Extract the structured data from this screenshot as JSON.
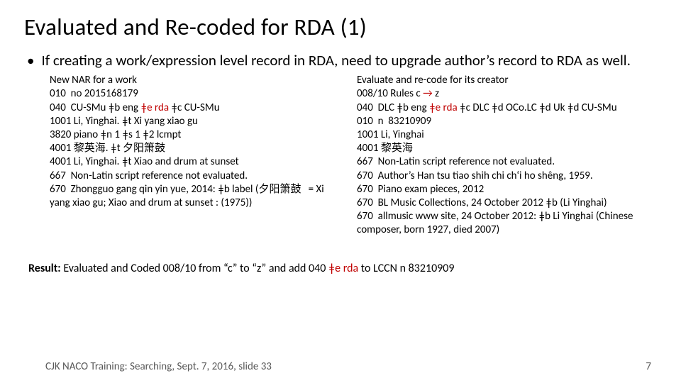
{
  "title": "Evaluated and Re-coded for RDA (1)",
  "bullet": "If creating a work/expression level record in RDA, need to upgrade author’s record to RDA as well.",
  "left": {
    "heading": "New NAR for a work",
    "l1": "010  no 2015168179",
    "l2a": "040  CU-SMu ǂb eng ",
    "l2_red": "ǂe rda",
    "l2b": " ǂc CU-SMu",
    "l3": "1001 Li, Yinghai. ǂt Xi yang xiao gu",
    "l4": "3820 piano ǂn 1 ǂs 1 ǂ2 lcmpt",
    "l5": "4001 黎英海. ǂt 夕阳箫鼓",
    "l6": "4001 Li, Yinghai. ǂt Xiao and drum at sunset",
    "l7": "667  Non-Latin script reference not evaluated.",
    "l8": "670  Zhongguo gang qin yin yue, 2014: ǂb label (夕阳箫鼓   = Xi yang xiao gu; Xiao and drum at sunset : (1975))"
  },
  "right": {
    "heading": "Evaluate and re-code for its creator",
    "r1a": "008/10 Rules c ",
    "r1_arrow": "→",
    "r1b": " z",
    "r2a": "040  DLC ǂb eng ",
    "r2_red": "ǂe rda",
    "r2b": " ǂc DLC ǂd OCo.LC ǂd Uk ǂd CU-SMu",
    "r3": "010  n  83210909",
    "r4": "1001 Li, Yinghai",
    "r5": "4001 黎英海",
    "r6": "667  Non-Latin script reference not evaluated.",
    "r7": "670  Author’s Han tsu tiao shih chi ch‘i ho shêng, 1959.",
    "r8": "670  Piano exam pieces, 2012",
    "r9": "670  BL Music Collections, 24 October 2012 ǂb (Li Yinghai)",
    "r10": "670  allmusic www site, 24 October 2012: ǂb Li Yinghai (Chinese composer, born 1927, died 2007)"
  },
  "result": {
    "label": "Result:  ",
    "a": "Evaluated and Coded 008/10 from “c” to “z” and add 040 ",
    "red": "ǂe rda",
    "b": " to LCCN n  83210909"
  },
  "footer_left": "CJK NACO Training: Searching, Sept. 7, 2016, slide 33",
  "footer_page": "7"
}
